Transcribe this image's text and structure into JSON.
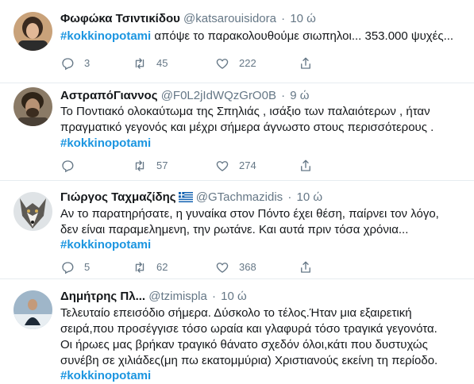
{
  "tweets": [
    {
      "name": "Φωφώκα Τσιντικίδου",
      "handle": "@katsarouisidora",
      "time": "10 ώ",
      "lines": [
        "απόψε το παρακολουθούμε σιωπηλοι... 353.000 ψυχές..."
      ],
      "hashtag": "#kokkinopotami",
      "reply_count": "3",
      "retweet_count": "45",
      "like_count": "222"
    },
    {
      "name": "ΑστραπόΓιαννος",
      "handle": "@F0L2jIdWQzGrO0B",
      "time": "9 ώ",
      "lines": [
        "Το Ποντιακό ολοκαύτωμα της Σπηλιάς , ισάξιο των παλαιότερων , ήταν",
        "πραγματικό γεγονός και μέχρι σήμερα άγνωστο στους περισσότερους ."
      ],
      "hashtag": "#kokkinopotami",
      "reply_count": "",
      "retweet_count": "57",
      "like_count": "274"
    },
    {
      "name": "Γιώργος Ταχμαζίδης",
      "handle": "@GTachmazidis",
      "time": "10 ώ",
      "lines": [
        "Αν το παρατηρήσατε, η γυναίκα στον Πόντο έχει θέση, παίρνει τον λόγο,",
        "δεν είναι παραμελημενη, την ρωτάνε. Και αυτά πριν τόσα χρόνια..."
      ],
      "hashtag": "#kokkinopotami",
      "reply_count": "5",
      "retweet_count": "62",
      "like_count": "368"
    },
    {
      "name": "Δημήτρης Πλ...",
      "handle": "@tzimispla",
      "time": "10 ώ",
      "lines": [
        "Τελευταίο επεισόδιο σήμερα. Δύσκολο το τέλος.Ήταν μια εξαιρετική",
        "σειρά,που προσέγγισε τόσο ωραία και γλαφυρά τόσο τραγικά γεγονότα.",
        "Οι ήρωες μας βρήκαν τραγικό θάνατο σχεδόν όλοι,κάτι που δυστυχώς",
        "συνέβη σε χιλιάδες(μη πω εκατομμύρια) Χριστιανούς εκείνη τη περίοδο."
      ],
      "hashtag": "#kokkinopotami"
    }
  ],
  "separator": "·",
  "icons": {
    "reply": "reply-icon",
    "retweet": "retweet-icon",
    "like": "heart-icon",
    "share": "share-icon"
  },
  "colors": {
    "hashtag": "#1b95e0",
    "secondary_text": "#657786",
    "divider": "#e6ecf0"
  }
}
